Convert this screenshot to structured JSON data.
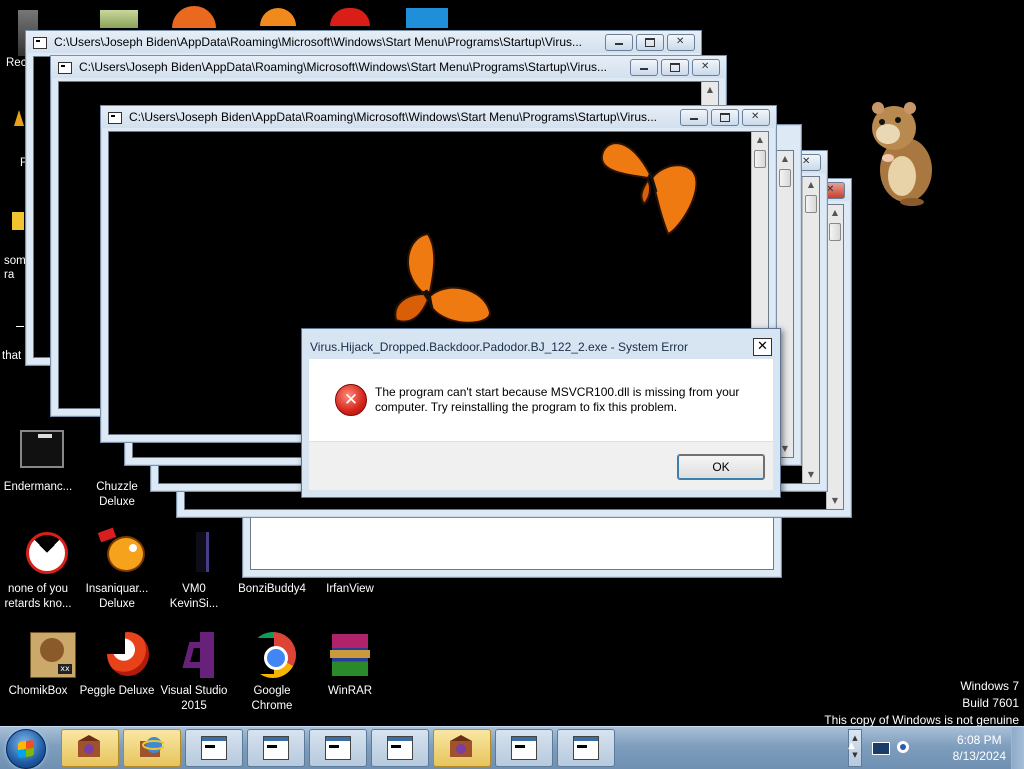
{
  "desktop": {
    "partial_icons": [
      {
        "label": "Rec"
      },
      {
        "label": "F"
      },
      {
        "label": "som\nra"
      },
      {
        "label": "that but i"
      }
    ],
    "icons": [
      {
        "label": "Endermanc...",
        "icon": "endermanch-icon"
      },
      {
        "label": "Chuzzle\nDeluxe",
        "icon": "chuzzle-icon"
      },
      {
        "label": "none of you\nretards kno...",
        "icon": "pacman-icon"
      },
      {
        "label": "Insaniquar...\nDeluxe",
        "icon": "insaniquarium-icon"
      },
      {
        "label": "VM0\nKevinSi...",
        "icon": "file-icon"
      },
      {
        "label": "BonziBuddy4",
        "icon": "bonzibuddy-icon"
      },
      {
        "label": "IrfanView",
        "icon": "irfanview-icon"
      },
      {
        "label": "ChomikBox",
        "icon": "chomikbox-icon"
      },
      {
        "label": "Peggle Deluxe",
        "icon": "peggle-icon"
      },
      {
        "label": "Visual Studio\n2015",
        "icon": "visual-studio-icon"
      },
      {
        "label": "Google\nChrome",
        "icon": "chrome-icon"
      },
      {
        "label": "WinRAR",
        "icon": "winrar-icon"
      }
    ]
  },
  "console_windows": [
    {
      "title": "C:\\Users\\Joseph Biden\\AppData\\Roaming\\Microsoft\\Windows\\Start Menu\\Programs\\Startup\\Virus..."
    },
    {
      "title": "C:\\Users\\Joseph Biden\\AppData\\Roaming\\Microsoft\\Windows\\Start Menu\\Programs\\Startup\\Virus..."
    },
    {
      "title": "C:\\Users\\Joseph Biden\\AppData\\Roaming\\Microsoft\\Windows\\Start Menu\\Programs\\Startup\\Virus..."
    }
  ],
  "error_dialog": {
    "title": "Virus.Hijack_Dropped.Backdoor.Padodor.BJ_122_2.exe - System Error",
    "message": "The program can't start because MSVCR100.dll is missing from your computer. Try reinstalling the program to fix this problem.",
    "ok_label": "OK"
  },
  "watermark": {
    "line1": "Windows 7",
    "line2": "Build 7601",
    "line3": "This copy of Windows is not genuine"
  },
  "taskbar": {
    "buttons": [
      {
        "kind": "bonzi-icon",
        "active": true
      },
      {
        "kind": "ie-icon",
        "active": true
      },
      {
        "kind": "console-icon",
        "active": false
      },
      {
        "kind": "console-icon",
        "active": false
      },
      {
        "kind": "console-icon",
        "active": false
      },
      {
        "kind": "console-icon",
        "active": false
      },
      {
        "kind": "bonzi-icon",
        "active": true
      },
      {
        "kind": "console-icon",
        "active": false
      },
      {
        "kind": "console-icon",
        "active": false
      }
    ],
    "clock": {
      "time": "6:08 PM",
      "date": "8/13/2024"
    }
  },
  "colors": {
    "desktop_bg": "#000000",
    "error_red": "#d4241a",
    "taskbar_active": "#e7c45d",
    "butterfly_orange": "#f07a12"
  }
}
